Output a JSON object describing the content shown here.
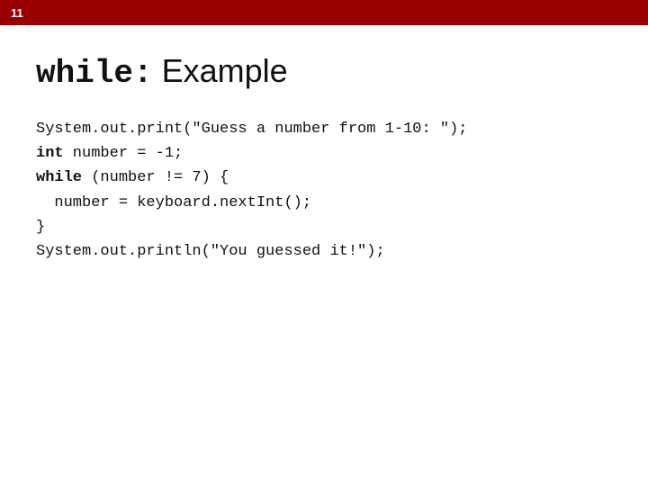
{
  "slide": {
    "number": "11",
    "title_code": "while:",
    "title_text": " Example",
    "top_bar_color": "#990000",
    "code_lines": [
      {
        "text": "System.out.print(\"Guess a number from 1-10: \");",
        "bold_words": []
      },
      {
        "text": "int number = -1;",
        "bold_words": [
          "int"
        ]
      },
      {
        "text": "while (number != 7) {",
        "bold_words": [
          "while"
        ]
      },
      {
        "text": "  number = keyboard.nextInt();",
        "bold_words": []
      },
      {
        "text": "}",
        "bold_words": []
      },
      {
        "text": "System.out.println(\"You guessed it!\");",
        "bold_words": []
      }
    ]
  }
}
